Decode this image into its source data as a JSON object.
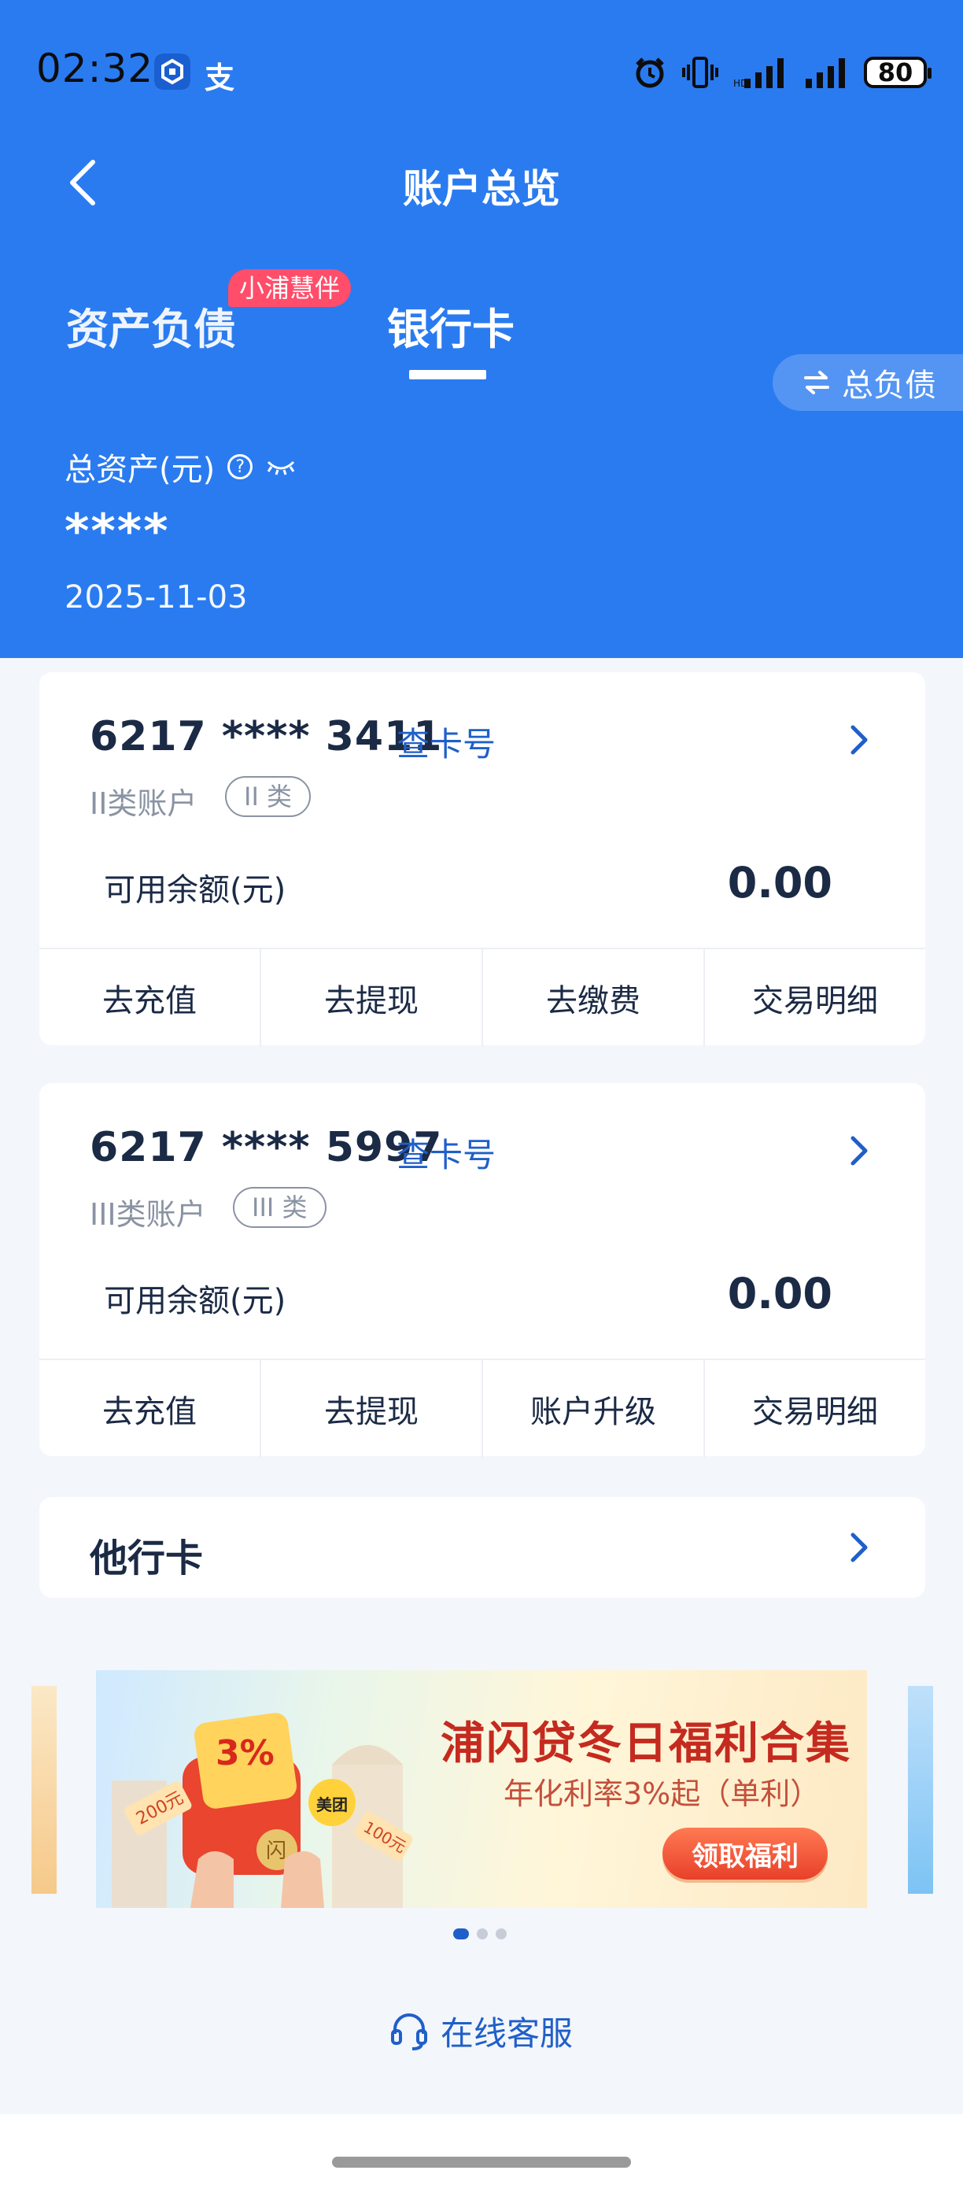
{
  "status_bar": {
    "time": "02:32",
    "app2_glyph": "支",
    "battery": "80",
    "icons": [
      "alarm-icon",
      "vibrate-icon",
      "signal-icon",
      "signal-icon"
    ]
  },
  "nav": {
    "title": "账户总览",
    "back_icon": "chevron-left-icon"
  },
  "tabs": [
    {
      "label": "资产负债"
    },
    {
      "label": "银行卡",
      "active": true
    }
  ],
  "badge": "小浦慧伴",
  "debt_toggle": {
    "icon": "swap-icon",
    "label": "总负债"
  },
  "assets": {
    "label": "总资产(元)",
    "value": "****",
    "date": "2025-11-03"
  },
  "cards": [
    {
      "number": "6217 **** 3411",
      "check_label": "查卡号",
      "type": "II类账户",
      "pill": "II 类",
      "balance_label": "可用余额(元)",
      "balance": "0.00",
      "actions": [
        "去充值",
        "去提现",
        "去缴费",
        "交易明细"
      ]
    },
    {
      "number": "6217 **** 5997",
      "check_label": "查卡号",
      "type": "III类账户",
      "pill": "III 类",
      "balance_label": "可用余额(元)",
      "balance": "0.00",
      "actions": [
        "去充值",
        "去提现",
        "账户升级",
        "交易明细"
      ]
    }
  ],
  "other_card": {
    "label": "他行卡"
  },
  "banner": {
    "title": "浦闪贷冬日福利合集",
    "subtitle": "年化利率3%起（单利）",
    "button": "领取福利",
    "art_text": {
      "rate": "3%",
      "coupon": "200元",
      "coupon2": "100元",
      "brand": "美团",
      "seal": "闪"
    }
  },
  "carousel": {
    "count": 3,
    "active": 0
  },
  "service": {
    "label": "在线客服",
    "icon": "headset-icon"
  },
  "colors": {
    "primary": "#2a7bf0",
    "link": "#1f5fc9",
    "badge": "#ff4d6a",
    "banner_title": "#c52a1f"
  }
}
